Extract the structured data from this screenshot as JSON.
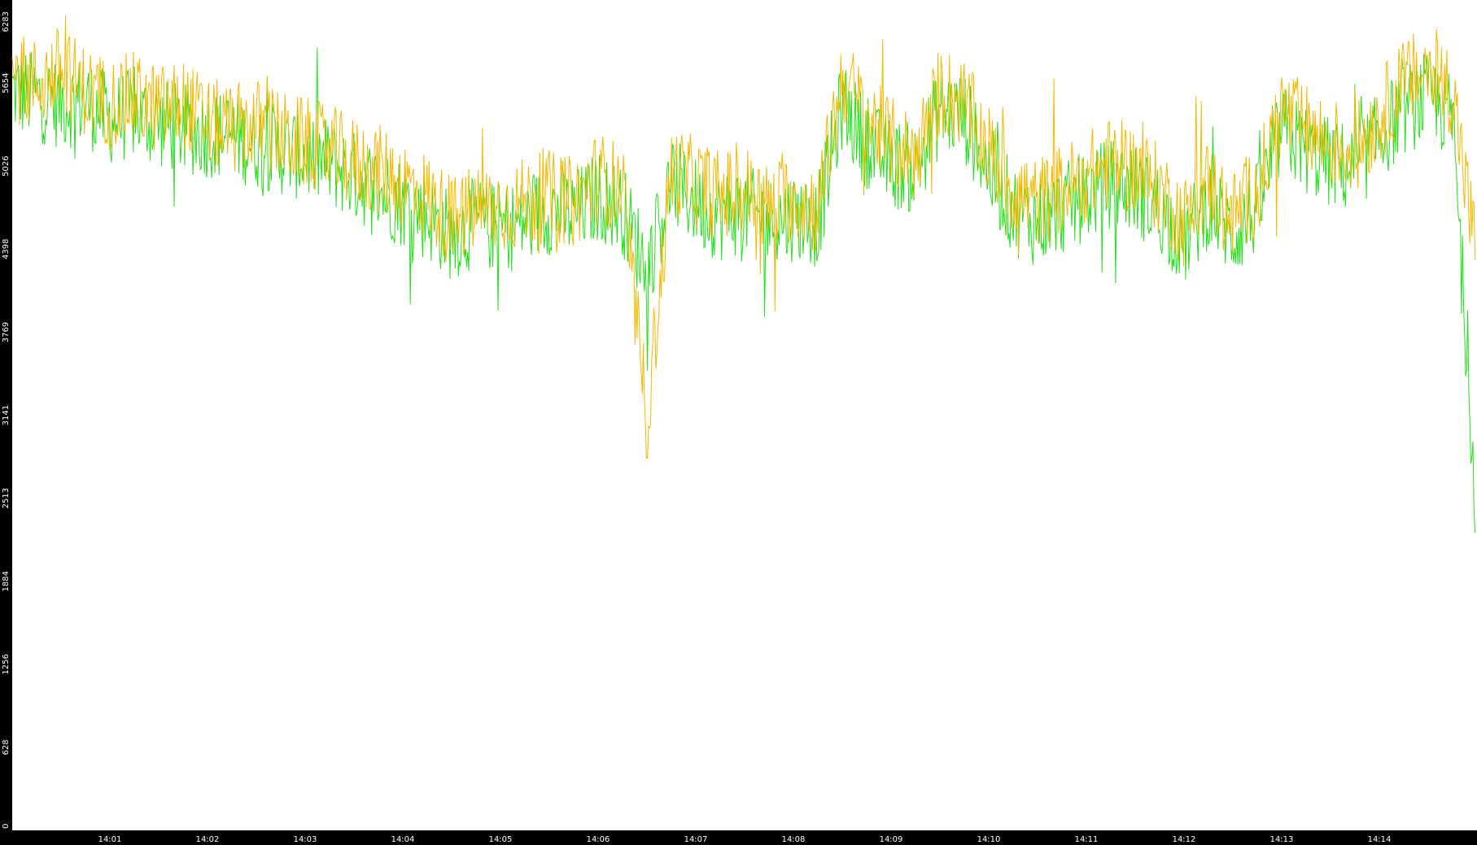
{
  "colors": {
    "background": "#000000",
    "plot_background": "#ffffff",
    "tick_text": "#ffffff",
    "series_green": "#22e01a",
    "series_orange": "#f5b800"
  },
  "chart_data": {
    "type": "line",
    "title": "",
    "xlabel": "",
    "ylabel": "",
    "ylim": [
      0,
      6283
    ],
    "xlim": [
      "14:00",
      "14:15"
    ],
    "grid": false,
    "legend": "none",
    "y_ticks": [
      "0",
      "628",
      "1256",
      "1884",
      "2513",
      "3141",
      "3769",
      "4398",
      "5026",
      "5654",
      "6283"
    ],
    "x_ticks": [
      "14:01",
      "14:02",
      "14:03",
      "14:04",
      "14:05",
      "14:06",
      "14:07",
      "14:08",
      "14:09",
      "14:10",
      "14:11",
      "14:12",
      "14:13",
      "14:14"
    ],
    "x_tick_times": [
      1,
      2,
      3,
      4,
      5,
      6,
      7,
      8,
      9,
      10,
      11,
      12,
      13,
      14
    ],
    "series": [
      {
        "color_key": "series_green",
        "x": [
          0,
          0.25,
          0.5,
          0.75,
          1,
          1.25,
          1.5,
          1.75,
          2,
          2.25,
          2.5,
          2.75,
          3,
          3.25,
          3.5,
          3.75,
          4,
          4.25,
          4.5,
          4.75,
          5,
          5.25,
          5.5,
          5.75,
          6,
          6.25,
          6.5,
          6.75,
          7,
          7.25,
          7.5,
          7.75,
          8,
          8.25,
          8.5,
          8.75,
          9,
          9.25,
          9.5,
          9.75,
          10,
          10.25,
          10.5,
          10.75,
          11,
          11.25,
          11.5,
          11.75,
          12,
          12.25,
          12.5,
          12.75,
          13,
          13.25,
          13.5,
          13.75,
          14,
          14.25,
          14.5,
          14.75,
          14.98
        ],
        "y": [
          5600,
          5550,
          5500,
          5520,
          5380,
          5420,
          5350,
          5300,
          5280,
          5250,
          5200,
          5150,
          5100,
          5050,
          4950,
          4850,
          4750,
          4650,
          4500,
          4600,
          4550,
          4600,
          4700,
          4650,
          4800,
          4700,
          4250,
          4900,
          4750,
          4650,
          4700,
          4600,
          4650,
          4600,
          5500,
          5200,
          5050,
          5000,
          5450,
          5400,
          5000,
          4700,
          4600,
          4700,
          4800,
          4900,
          4850,
          4700,
          4450,
          4750,
          4500,
          4700,
          5300,
          5150,
          5050,
          5000,
          5250,
          5450,
          5550,
          5400,
          2600
        ]
      },
      {
        "color_key": "series_orange",
        "x": [
          0,
          0.25,
          0.5,
          0.75,
          1,
          1.25,
          1.5,
          1.75,
          2,
          2.25,
          2.5,
          2.75,
          3,
          3.25,
          3.5,
          3.75,
          4,
          4.25,
          4.5,
          4.75,
          5,
          5.25,
          5.5,
          5.75,
          6,
          6.25,
          6.5,
          6.75,
          7,
          7.25,
          7.5,
          7.75,
          8,
          8.25,
          8.5,
          8.75,
          9,
          9.25,
          9.5,
          9.75,
          10,
          10.25,
          10.5,
          10.75,
          11,
          11.25,
          11.5,
          11.75,
          12,
          12.25,
          12.5,
          12.75,
          13,
          13.25,
          13.5,
          13.75,
          14,
          14.25,
          14.5,
          14.75,
          14.98
        ],
        "y": [
          5700,
          5650,
          5750,
          5600,
          5500,
          5550,
          5450,
          5500,
          5350,
          5300,
          5350,
          5250,
          5200,
          5150,
          5050,
          5000,
          4900,
          4800,
          4600,
          4700,
          4700,
          4750,
          4800,
          4750,
          4950,
          4850,
          3100,
          5000,
          4900,
          4800,
          4850,
          4700,
          4800,
          4700,
          5700,
          5400,
          5200,
          5100,
          5600,
          5500,
          5150,
          4850,
          4750,
          4850,
          4950,
          5050,
          5000,
          4850,
          4600,
          4900,
          4650,
          4850,
          5450,
          5300,
          5200,
          5150,
          5400,
          5650,
          5750,
          5600,
          4400
        ]
      }
    ]
  }
}
